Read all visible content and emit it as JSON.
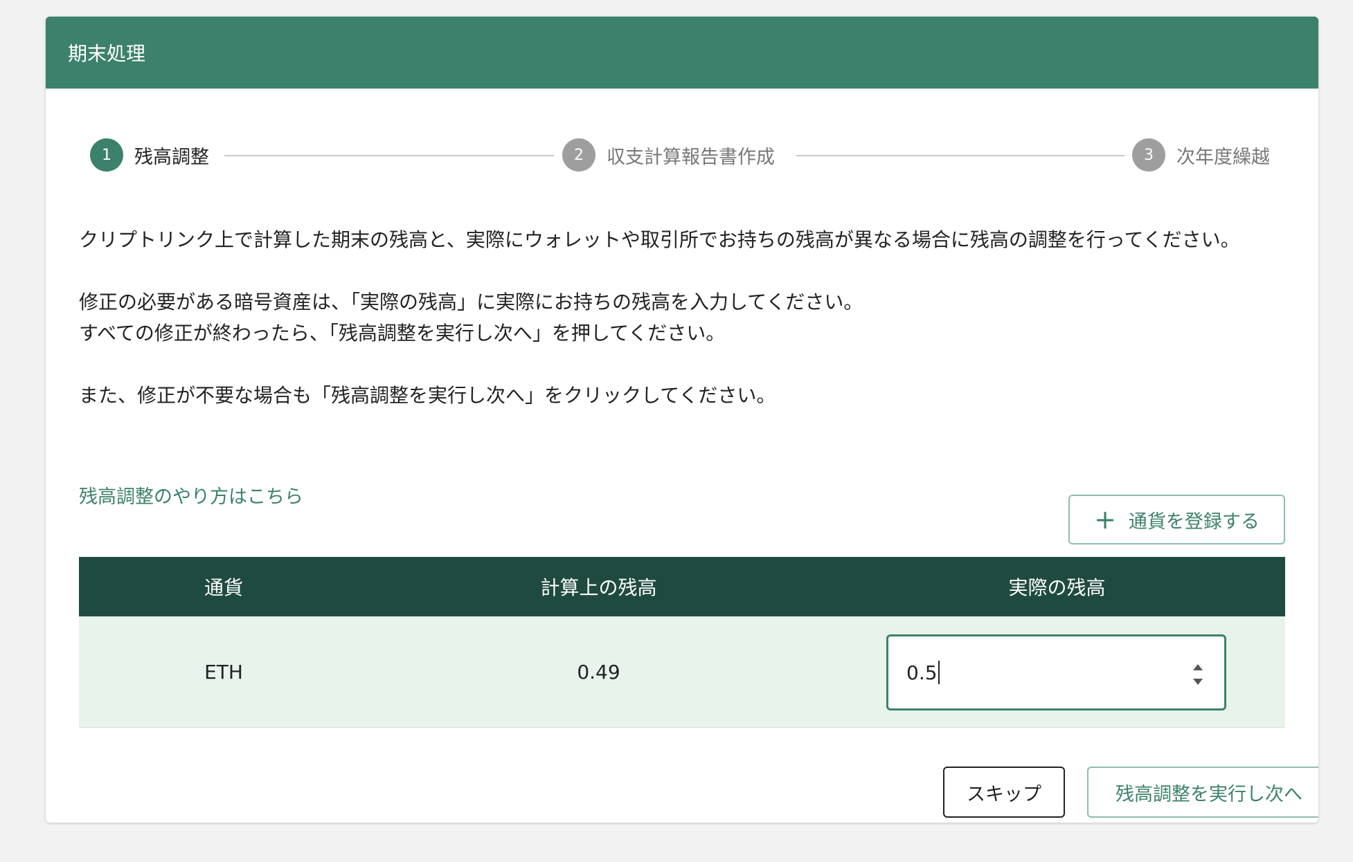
{
  "header": {
    "title": "期末処理"
  },
  "stepper": {
    "steps": [
      {
        "number": "1",
        "label": "残高調整",
        "status": "active"
      },
      {
        "number": "2",
        "label": "収支計算報告書作成",
        "status": "inactive"
      },
      {
        "number": "3",
        "label": "次年度繰越",
        "status": "inactive"
      }
    ]
  },
  "instructions": {
    "paragraph1": "クリプトリンク上で計算した期末の残高と、実際にウォレットや取引所でお持ちの残高が異なる場合に残高の調整を行ってください。",
    "paragraph2_line1": "修正の必要がある暗号資産は、「実際の残高」に実際にお持ちの残高を入力してください。",
    "paragraph2_line2": "すべての修正が終わったら、「残高調整を実行し次へ」を押してください。",
    "paragraph3": "また、修正が不要な場合も「残高調整を実行し次へ」をクリックしてください。"
  },
  "help_link": {
    "label": "残高調整のやり方はこちら"
  },
  "add_currency_button": {
    "label": "通貨を登録する",
    "icon": "plus-icon"
  },
  "table": {
    "columns": [
      "通貨",
      "計算上の残高",
      "実際の残高"
    ],
    "rows": [
      {
        "currency": "ETH",
        "calculated_balance": "0.49",
        "actual_balance": "0.5"
      }
    ]
  },
  "actions": {
    "skip_label": "スキップ",
    "next_label": "残高調整を実行し次へ"
  },
  "colors": {
    "primary": "#3c816b",
    "header_bg": "#3c816b",
    "table_header_bg": "#1f4a3f",
    "row_bg": "#e8f4eb",
    "inactive_step": "#9e9e9e"
  }
}
